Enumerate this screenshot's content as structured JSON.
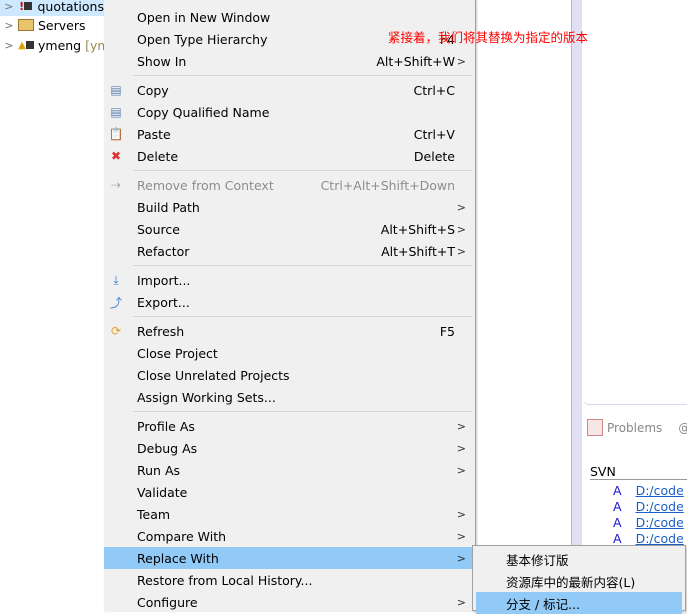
{
  "tree": {
    "items": [
      {
        "label": "quotations",
        "icon": "java-project-error-icon",
        "selected": true
      },
      {
        "label": "Servers",
        "icon": "folder-open-icon"
      },
      {
        "label": "ymeng",
        "suffix": "[ym",
        "icon": "java-project-warning-icon"
      }
    ]
  },
  "annotation": "紧接着，我们将其替换为指定的版本",
  "context_menu": {
    "groups": [
      [
        {
          "label": "Open in New Window"
        },
        {
          "label": "Open Type Hierarchy",
          "shortcut": "F4"
        },
        {
          "label": "Show In",
          "shortcut": "Alt+Shift+W",
          "submenu": true
        }
      ],
      [
        {
          "label": "Copy",
          "shortcut": "Ctrl+C",
          "icon": "copy-icon"
        },
        {
          "label": "Copy Qualified Name",
          "icon": "copy-qualified-icon"
        },
        {
          "label": "Paste",
          "shortcut": "Ctrl+V",
          "icon": "paste-icon"
        },
        {
          "label": "Delete",
          "shortcut": "Delete",
          "icon": "delete-icon"
        }
      ],
      [
        {
          "label": "Remove from Context",
          "shortcut": "Ctrl+Alt+Shift+Down",
          "icon": "remove-context-icon",
          "disabled": true
        },
        {
          "label": "Build Path",
          "submenu": true
        },
        {
          "label": "Source",
          "shortcut": "Alt+Shift+S",
          "submenu": true
        },
        {
          "label": "Refactor",
          "shortcut": "Alt+Shift+T",
          "submenu": true
        }
      ],
      [
        {
          "label": "Import...",
          "icon": "import-icon"
        },
        {
          "label": "Export...",
          "icon": "export-icon"
        }
      ],
      [
        {
          "label": "Refresh",
          "shortcut": "F5",
          "icon": "refresh-icon"
        },
        {
          "label": "Close Project"
        },
        {
          "label": "Close Unrelated Projects"
        },
        {
          "label": "Assign Working Sets..."
        }
      ],
      [
        {
          "label": "Profile As",
          "submenu": true
        },
        {
          "label": "Debug As",
          "submenu": true
        },
        {
          "label": "Run As",
          "submenu": true
        },
        {
          "label": "Validate"
        },
        {
          "label": "Team",
          "submenu": true
        },
        {
          "label": "Compare With",
          "submenu": true
        },
        {
          "label": "Replace With",
          "submenu": true,
          "highlighted": true
        },
        {
          "label": "Restore from Local History..."
        },
        {
          "label": "Configure",
          "submenu": true
        }
      ]
    ]
  },
  "submenu": {
    "items": [
      {
        "label": "基本修订版"
      },
      {
        "label": "资源库中的最新内容(L)"
      },
      {
        "label": "分支 / 标记...",
        "highlighted": true
      }
    ]
  },
  "bottom_panel": {
    "tab_label": "Problems",
    "tab2_label": "@",
    "section": "SVN",
    "rows": [
      {
        "action": "A",
        "path": "D:/code"
      },
      {
        "action": "A",
        "path": "D:/code"
      },
      {
        "action": "A",
        "path": "D:/code"
      },
      {
        "action": "A",
        "path": "D:/code"
      }
    ]
  },
  "colors": {
    "highlight": "#91c9f7",
    "annotation": "#ff0000",
    "menu_bg": "#f0f0f0",
    "svn_action": "#1a1acc",
    "link": "#1a5fc8"
  }
}
